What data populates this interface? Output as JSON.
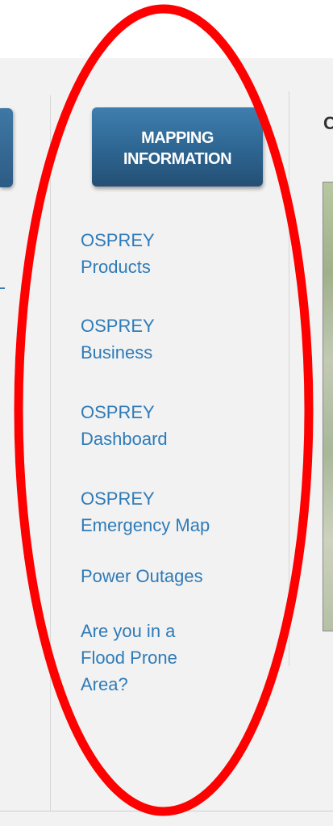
{
  "mapping_section": {
    "button_label": "MAPPING\nINFORMATION",
    "links": [
      {
        "label": "OSPREY\nProducts"
      },
      {
        "label": "OSPREY\nBusiness"
      },
      {
        "label": "OSPREY\nDashboard"
      },
      {
        "label": "OSPREY\nEmergency Map"
      },
      {
        "label": "Power Outages"
      },
      {
        "label": "Are you in a\nFlood Prone\nArea?"
      }
    ]
  },
  "right_column": {
    "heading_fragment": "C"
  },
  "colors": {
    "link": "#2f7bb8",
    "button": "#2d6591",
    "highlight": "#ff0000",
    "panel_bg": "#f2f2f2"
  }
}
